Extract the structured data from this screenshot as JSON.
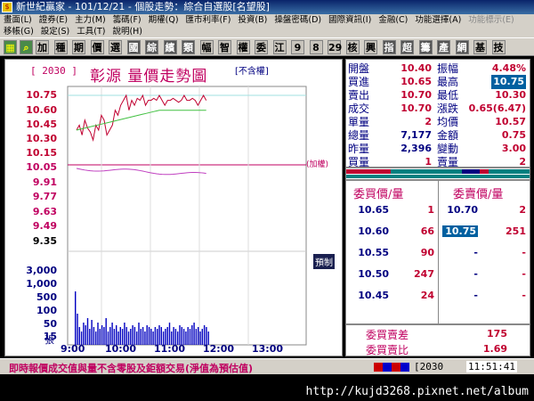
{
  "window": {
    "title": "新世紀贏家 - 101/12/21 - 個股走勢：綜合自選股[名望股]"
  },
  "menu": {
    "row1": [
      "畫面(L)",
      "證券(E)",
      "主力(M)",
      "籌碼(F)",
      "期權(Q)",
      "匯市利率(F)",
      "投資(B)",
      "操盤密碼(D)",
      "國際資訊(I)",
      "金融(C)",
      "功能選擇(A)"
    ],
    "row1_disabled": "功能標示(E)",
    "row2": [
      "移帳(G)",
      "設定(S)",
      "工具(T)",
      "說明(H)"
    ]
  },
  "toolbar": {
    "buttons": [
      "加",
      "種",
      "期",
      "價",
      "選",
      "國",
      "綜",
      "繽",
      "類",
      "幅",
      "智",
      "權",
      "委",
      "江",
      "9",
      "8",
      "29",
      "核",
      "興",
      "指",
      "超",
      "籌",
      "產",
      "網",
      "基",
      "技"
    ]
  },
  "chart": {
    "code": "[ 2030 ]",
    "title": "彰源  量價走勢圖",
    "unadjusted": "[不含權]",
    "weighted_label": "(加權)",
    "fixed_price_label": "預制",
    "volume_unit": "張"
  },
  "chart_data": {
    "type": "line",
    "title": "彰源  量價走勢圖",
    "price_ticks": [
      "10.75",
      "10.60",
      "10.45",
      "10.30",
      "10.15",
      "10.05",
      "9.91",
      "9.77",
      "9.63",
      "9.49",
      "9.35"
    ],
    "volume_ticks": [
      "3,000",
      "1,000",
      "500",
      "100",
      "50",
      "15"
    ],
    "x_ticks": [
      "9:00",
      "10:00",
      "11:00",
      "12:00",
      "13:00"
    ],
    "reference_price": 10.05,
    "series": []
  },
  "quote": {
    "rows": [
      {
        "l1": "開盤",
        "v1": "10.40",
        "l2": "振幅",
        "v2": "4.48%"
      },
      {
        "l1": "買進",
        "v1": "10.65",
        "l2": "最高",
        "v2": "10.75"
      },
      {
        "l1": "賣出",
        "v1": "10.70",
        "l2": "最低",
        "v2": "10.30"
      },
      {
        "l1": "成交",
        "v1": "10.70",
        "l2": "漲跌",
        "v2": "0.65(6.47)"
      },
      {
        "l1": "單量",
        "v1": "2",
        "l2": "均價",
        "v2": "10.57"
      },
      {
        "l1": "總量",
        "v1": "7,177",
        "l2": "金額",
        "v2": "0.75"
      },
      {
        "l1": "昨量",
        "v1": "2,396",
        "l2": "變動",
        "v2": "3.00"
      },
      {
        "l1": "買量",
        "v1": "1",
        "l2": "賣量",
        "v2": "2"
      }
    ]
  },
  "orderbook": {
    "bid_header": "委買價/量",
    "ask_header": "委賣價/量",
    "bids": [
      {
        "price": "10.65",
        "qty": "1"
      },
      {
        "price": "10.60",
        "qty": "66"
      },
      {
        "price": "10.55",
        "qty": "90"
      },
      {
        "price": "10.50",
        "qty": "247"
      },
      {
        "price": "10.45",
        "qty": "24"
      }
    ],
    "asks": [
      {
        "price": "10.70",
        "qty": "2"
      },
      {
        "price": "10.75",
        "qty": "251"
      },
      {
        "price": "-",
        "qty": "-"
      },
      {
        "price": "-",
        "qty": "-"
      },
      {
        "price": "-",
        "qty": "-"
      }
    ],
    "diff_label": "委買賣差",
    "diff_value": "175",
    "ratio_label": "委買賣比",
    "ratio_value": "1.69"
  },
  "status": {
    "note": "即時報價成交值與量不含零股及鉅額交易(淨值為預估值)",
    "code": "[2030",
    "time": "11:51:41"
  },
  "watermark": "http://kujd3268.pixnet.net/album"
}
